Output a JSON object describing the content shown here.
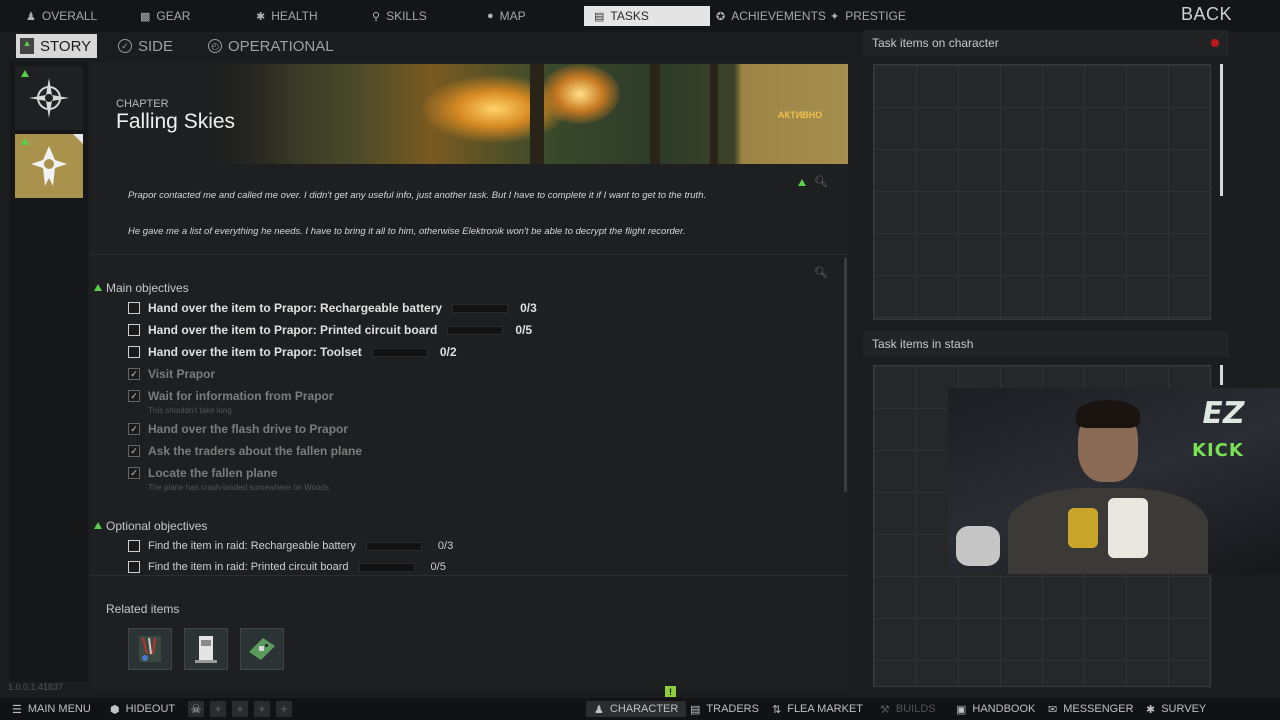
{
  "topnav": {
    "tabs": [
      {
        "label": "OVERALL",
        "icon": "person-icon"
      },
      {
        "label": "GEAR",
        "icon": "gear-icon"
      },
      {
        "label": "HEALTH",
        "icon": "health-icon"
      },
      {
        "label": "SKILLS",
        "icon": "skills-icon"
      },
      {
        "label": "MAP",
        "icon": "map-pin-icon"
      },
      {
        "label": "TASKS",
        "icon": "tasks-icon",
        "active": true
      },
      {
        "label": "ACHIEVEMENTS",
        "icon": "achievement-icon"
      },
      {
        "label": "PRESTIGE",
        "icon": "prestige-icon"
      }
    ],
    "back_label": "BACK"
  },
  "subtabs": [
    {
      "label": "STORY",
      "active": true
    },
    {
      "label": "SIDE"
    },
    {
      "label": "OPERATIONAL"
    }
  ],
  "quest": {
    "chapter_label": "CHAPTER",
    "title": "Falling Skies",
    "status": "АКТИВНО",
    "description": [
      "Prapor contacted me and called me over. I didn't get any useful info, just another task. But I have to complete it if I want to get to the truth.",
      "He gave me a list of everything he needs. I have to bring it all to him, otherwise Elektronik won't be able to decrypt the flight recorder."
    ]
  },
  "main_objectives": {
    "title": "Main objectives",
    "items": [
      {
        "label": "Hand over the item to Prapor: Rechargeable battery",
        "count": "0/3",
        "progress": 0,
        "done": false
      },
      {
        "label": "Hand over the item to Prapor: Printed circuit board",
        "count": "0/5",
        "progress": 0,
        "done": false
      },
      {
        "label": "Hand over the item to Prapor: Toolset",
        "count": "0/2",
        "progress": 0,
        "done": false
      },
      {
        "label": "Visit Prapor",
        "done": true
      },
      {
        "label": "Wait for information from Prapor",
        "note": "This shouldn't take long",
        "done": true
      },
      {
        "label": "Hand over the flash drive to Prapor",
        "done": true
      },
      {
        "label": "Ask the traders about the fallen plane",
        "done": true
      },
      {
        "label": "Locate the fallen plane",
        "note": "The plane has crash-landed somewhere on Woods",
        "done": true
      }
    ]
  },
  "optional_objectives": {
    "title": "Optional objectives",
    "items": [
      {
        "label": "Find the item in raid: Rechargeable battery",
        "count": "0/3",
        "progress": 0
      },
      {
        "label": "Find the item in raid: Printed circuit board",
        "count": "0/5",
        "progress": 0
      }
    ]
  },
  "related": {
    "title": "Related items",
    "items": [
      {
        "icon": "toolset-icon"
      },
      {
        "icon": "battery-icon"
      },
      {
        "icon": "circuit-board-icon"
      }
    ]
  },
  "right_panels": {
    "on_character": "Task items on character",
    "in_stash": "Task items in stash"
  },
  "stream_overlay": {
    "logo": "EZ",
    "platform": "KICK"
  },
  "version": "1.0.0.1.41837",
  "bottombar": {
    "main_menu": "MAIN MENU",
    "hideout": "HIDEOUT",
    "character": "CHARACTER",
    "traders": "TRADERS",
    "flea_market": "FLEA MARKET",
    "builds": "BUILDS",
    "handbook": "HANDBOOK",
    "messenger": "MESSENGER",
    "survey": "SURVEY",
    "notification": "!"
  }
}
